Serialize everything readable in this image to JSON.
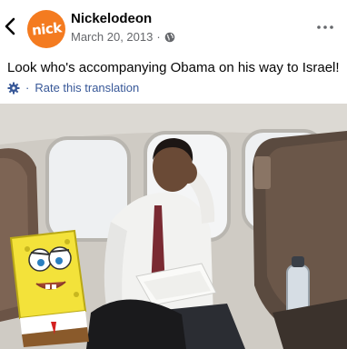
{
  "post": {
    "page_name": "Nickelodeon",
    "avatar_text": "nick",
    "date": "March 20, 2013",
    "separator": "·",
    "text": "Look who's accompanying Obama on his way to Israel!",
    "translate_label": "Rate this translation"
  },
  "icons": {
    "back": "chevron-left-icon",
    "privacy": "globe-icon",
    "more": "more-options-icon",
    "translate": "gear-icon"
  },
  "colors": {
    "brand_orange": "#f47b20",
    "link_blue": "#385898",
    "meta_gray": "#65676b"
  }
}
